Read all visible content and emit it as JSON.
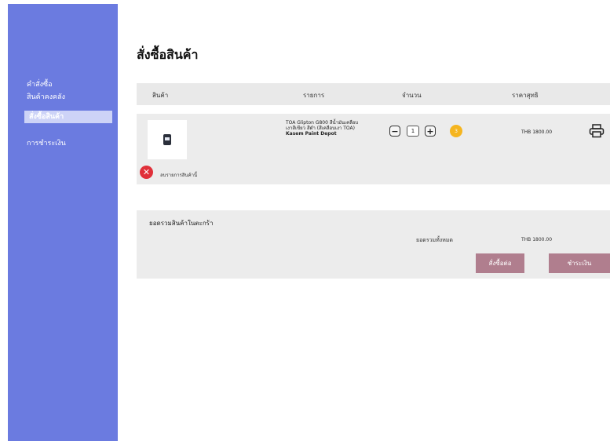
{
  "sidebar": {
    "items": [
      {
        "label": "คำสั่งซื้อ"
      },
      {
        "label": "สินค้าคงคลัง"
      },
      {
        "label": "สั่งซื้อสินค้า"
      },
      {
        "label": "การชำระเงิน"
      }
    ],
    "active_index": 2
  },
  "page": {
    "title": "สั่งซื้อสินค้า"
  },
  "table": {
    "headers": [
      "สินค้า",
      "รายการ",
      "จำนวน",
      "ราคาสุทธิ"
    ]
  },
  "item": {
    "image_icon": "paint-can-icon",
    "description_lines": [
      "TOA Glipton G800 สีน้ำมันเคลือบ",
      "เงาสีเขียว สีดำ (สีเคลือบเงา TOA)"
    ],
    "store": "Kasem Paint Depot",
    "quantity": "1",
    "badge_count": "3",
    "price": "THB 1800.00",
    "remove_label": "ลบรายการสินค้านี้"
  },
  "summary": {
    "title": "ยอดรวมสินค้าในตะกร้า",
    "total_label": "ยอดรวมทั้งหมด",
    "total_value": "THB 1800.00",
    "buttons": {
      "order": "สั่งซื้อต่อ",
      "pay": "ชำระเงิน"
    }
  },
  "colors": {
    "sidebar": "#6b7be0",
    "sidebar_active": "#cdd3f7",
    "accent_button": "#b07e8e",
    "remove": "#e0303a",
    "badge": "#f5b51f"
  }
}
